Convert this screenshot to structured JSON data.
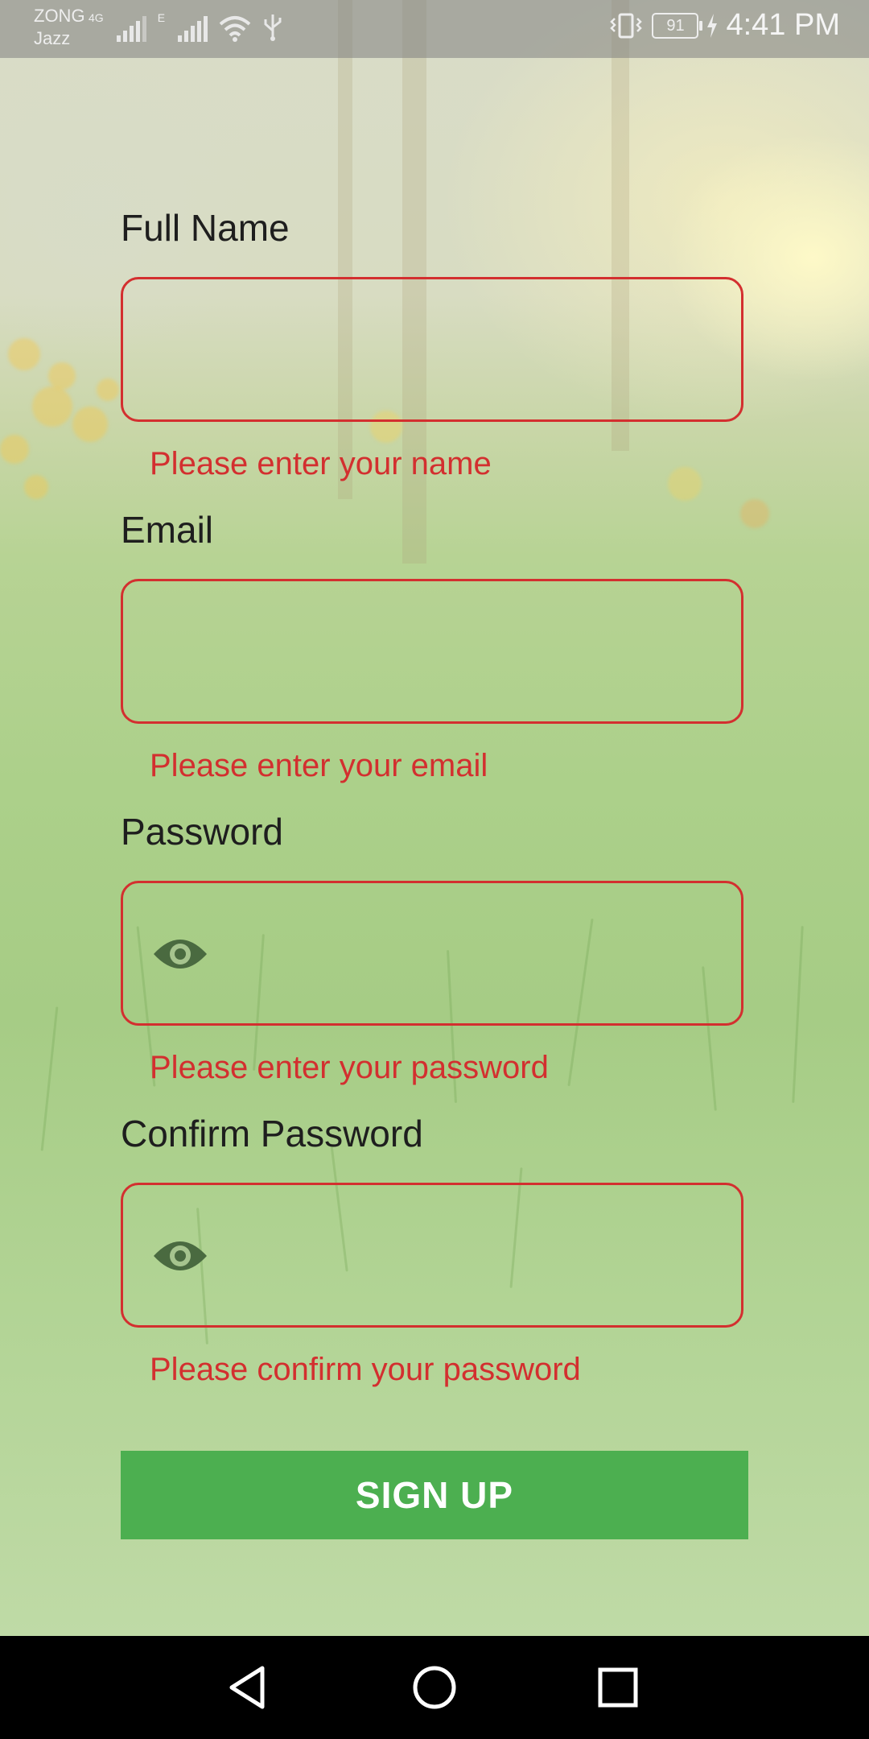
{
  "status_bar": {
    "carrier_1": "ZONG",
    "carrier_2": "Jazz",
    "network_1": "4G",
    "network_2": "E",
    "battery_level": "91",
    "time": "4:41 PM"
  },
  "form": {
    "full_name": {
      "label": "Full Name",
      "value": "",
      "error": "Please enter your name"
    },
    "email": {
      "label": "Email",
      "value": "",
      "error": "Please enter your email"
    },
    "password": {
      "label": "Password",
      "value": "",
      "error": "Please enter your password"
    },
    "confirm_password": {
      "label": "Confirm Password",
      "value": "",
      "error": "Please confirm your password"
    },
    "submit_label": "SIGN UP"
  },
  "colors": {
    "error": "#d32f2f",
    "button": "#4caf50",
    "eye_icon": "#4a6a40"
  },
  "icons": {
    "password_toggle": "eye-icon",
    "nav_back": "back-triangle-icon",
    "nav_home": "home-circle-icon",
    "nav_recents": "recents-square-icon"
  }
}
